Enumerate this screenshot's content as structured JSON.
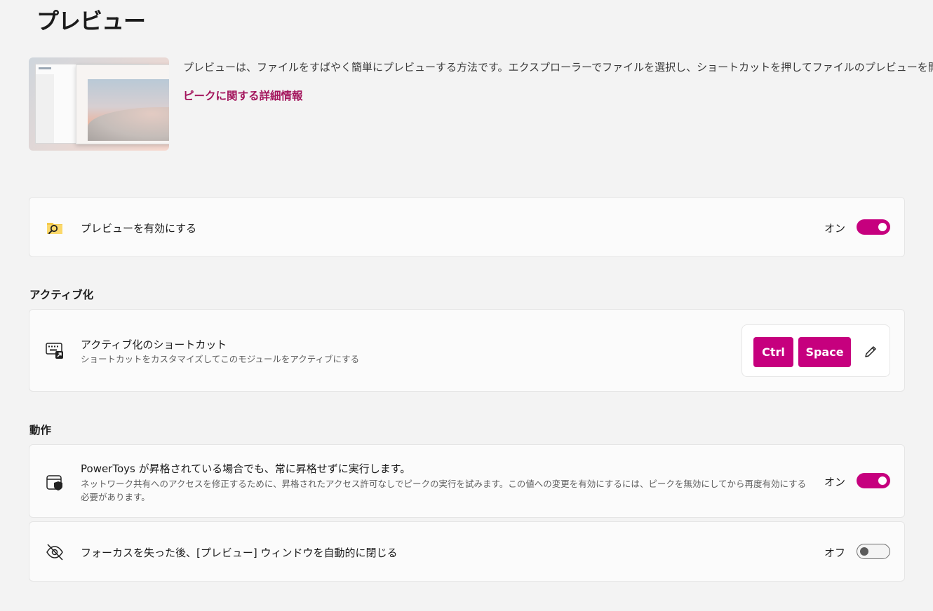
{
  "page": {
    "title": "プレビュー",
    "description": "プレビューは、ファイルをすばやく簡単にプレビューする方法です。エクスプローラーでファイルを選択し、ショートカットを押してファイルのプレビューを開きます。",
    "learn_more_link": "ピークに関する詳細情報"
  },
  "enable_card": {
    "title": "プレビューを有効にする",
    "state_label": "オン",
    "enabled": true,
    "icon": "peek-folder-icon"
  },
  "activation": {
    "header": "アクティブ化",
    "shortcut_card": {
      "title": "アクティブ化のショートカット",
      "subtitle": "ショートカットをカスタマイズしてこのモジュールをアクティブにする",
      "keys": [
        "Ctrl",
        "Space"
      ],
      "icon": "keyboard-shortcut-icon"
    }
  },
  "behavior": {
    "header": "動作",
    "elevated_card": {
      "title": "PowerToys が昇格されている場合でも、常に昇格せずに実行します。",
      "subtitle": "ネットワーク共有へのアクセスを修正するために、昇格されたアクセス許可なしでピークの実行を試みます。この値への変更を有効にするには、ピークを無効にしてから再度有効にする必要があります。",
      "state_label": "オン",
      "enabled": true,
      "icon": "shield-window-icon"
    },
    "close_on_focus_card": {
      "title": "フォーカスを失った後、[プレビュー] ウィンドウを自動的に閉じる",
      "state_label": "オフ",
      "enabled": false,
      "icon": "eye-hidden-icon"
    }
  },
  "colors": {
    "accent": "#c6007e",
    "link": "#a3145c",
    "background": "#f3f3f3",
    "card": "#fbfbfb"
  }
}
